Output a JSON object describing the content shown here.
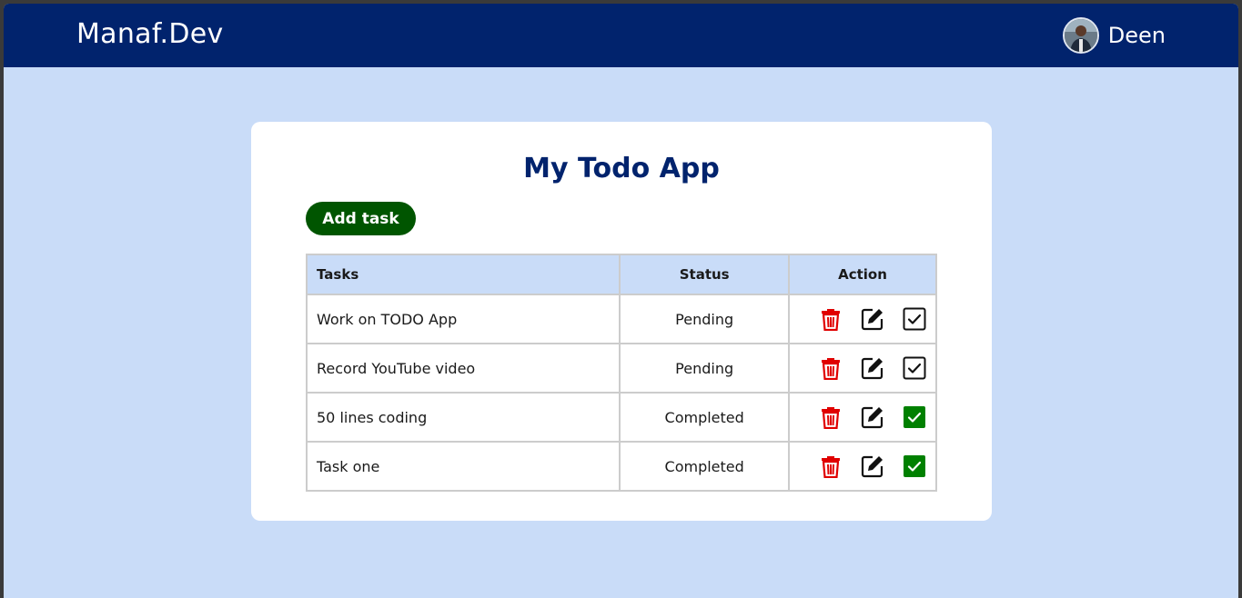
{
  "header": {
    "brand": "Manaf.Dev",
    "user_name": "Deen"
  },
  "main": {
    "title": "My Todo App",
    "add_button_label": "Add task",
    "table": {
      "headers": [
        "Tasks",
        "Status",
        "Action"
      ],
      "rows": [
        {
          "task": "Work on TODO App",
          "status": "Pending",
          "completed": false
        },
        {
          "task": "Record YouTube video",
          "status": "Pending",
          "completed": false
        },
        {
          "task": "50 lines coding",
          "status": "Completed",
          "completed": true
        },
        {
          "task": "Task one",
          "status": "Completed",
          "completed": true
        }
      ]
    }
  },
  "icons": {
    "delete": "trash-icon",
    "edit": "edit-icon",
    "complete": "checkbox-icon"
  },
  "colors": {
    "navbar": "#01236d",
    "background": "#c9dcf8",
    "add_button": "#005500",
    "delete_icon": "#e00000",
    "checked_box": "#008000"
  }
}
